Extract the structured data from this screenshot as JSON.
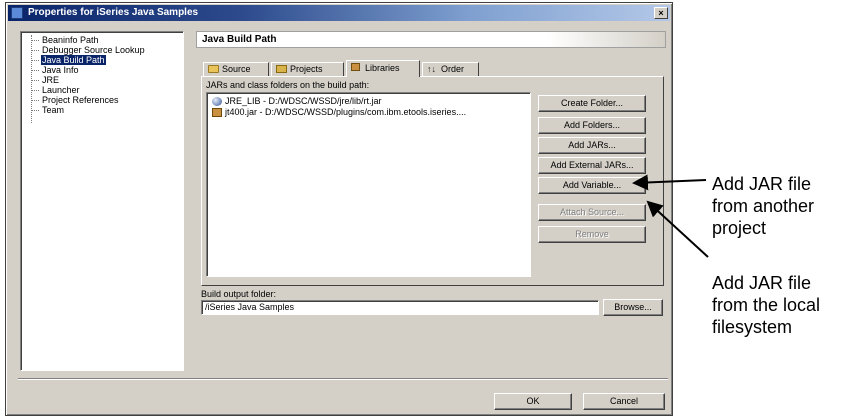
{
  "window": {
    "title": "Properties for iSeries Java Samples",
    "close_glyph": "×"
  },
  "tree": {
    "items": [
      {
        "label": "Beaninfo Path",
        "selected": false
      },
      {
        "label": "Debugger Source Lookup",
        "selected": false
      },
      {
        "label": "Java Build Path",
        "selected": true
      },
      {
        "label": "Java Info",
        "selected": false
      },
      {
        "label": "JRE",
        "selected": false
      },
      {
        "label": "Launcher",
        "selected": false
      },
      {
        "label": "Project References",
        "selected": false
      },
      {
        "label": "Team",
        "selected": false
      }
    ]
  },
  "page": {
    "title": "Java Build Path"
  },
  "tabs": [
    {
      "label": "Source",
      "icon": "folder-icon"
    },
    {
      "label": "Projects",
      "icon": "projects-icon"
    },
    {
      "label": "Libraries",
      "icon": "libraries-icon",
      "active": true
    },
    {
      "label": "Order",
      "icon": "order-icon"
    }
  ],
  "libraries": {
    "list_label": "JARs and class folders on the build path:",
    "entries": [
      {
        "text": "JRE_LIB - D:/WDSC/WSSD/jre/lib/rt.jar",
        "icon": "jre-icon"
      },
      {
        "text": "jt400.jar - D:/WDSC/WSSD/plugins/com.ibm.etools.iseries....",
        "icon": "jar-icon"
      }
    ],
    "buttons": {
      "create_folder": "Create Folder...",
      "add_folders": "Add Folders...",
      "add_jars": "Add JARs...",
      "add_external_jars": "Add External JARs...",
      "add_variable": "Add Variable...",
      "attach_source": "Attach Source...",
      "remove": "Remove"
    }
  },
  "output": {
    "label": "Build output folder:",
    "value": "/iSeries Java Samples",
    "browse": "Browse..."
  },
  "footer": {
    "ok": "OK",
    "cancel": "Cancel"
  },
  "annotations": {
    "top": [
      "Add JAR file",
      "from another",
      "project"
    ],
    "bottom": [
      "Add JAR file",
      "from the local",
      "filesystem"
    ]
  },
  "colors": {
    "selection": "#0a246a",
    "dialog_bg": "#d4d0c8",
    "title_start": "#0a246a"
  }
}
